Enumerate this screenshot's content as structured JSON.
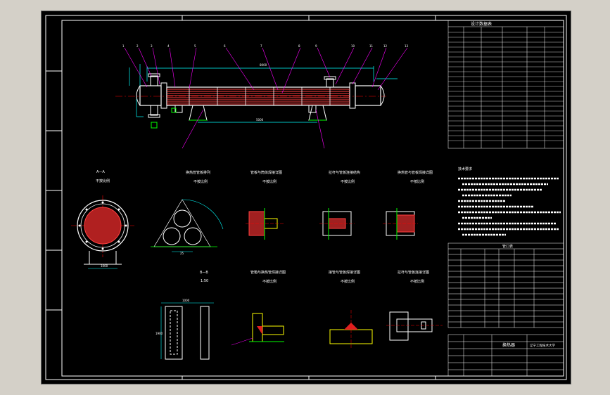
{
  "drawing": {
    "spec_table_title": "设计数据表",
    "section_a": "A—A",
    "scale_a": "不按比例",
    "section_b": "B—B",
    "scale_b": "1:50",
    "scale_generic": "不按比例",
    "detail_titles": [
      "换热管管板排列",
      "管板与筒体焊接详图",
      "拉杆与管板连接结构",
      "换热管与管板焊接详图",
      "管箱与换热管焊接详图",
      "接管与管板焊接详图",
      "拉杆与管板连接详图"
    ],
    "notes_title": "技术要求",
    "nozzle_table_title": "管口表",
    "title_block_name": "换热器",
    "title_block_school": "辽宁工程技术大学",
    "dims": {
      "overall": "8000",
      "support_span": "5000",
      "saddle_width": "300",
      "tube_pitch": "25",
      "b_width": "1000",
      "b_height": "1900",
      "a_base": "1000"
    }
  },
  "colors": {
    "background": "#000000",
    "frame": "#ffffff",
    "leader": "#ff00ff",
    "dimension": "#00ffff",
    "center_line": "#ff0000",
    "detail": "#ffff00",
    "tube": "#ff4040",
    "hatch": "#ff3030",
    "weld": "#ff0000",
    "green_line": "#00ff00"
  }
}
